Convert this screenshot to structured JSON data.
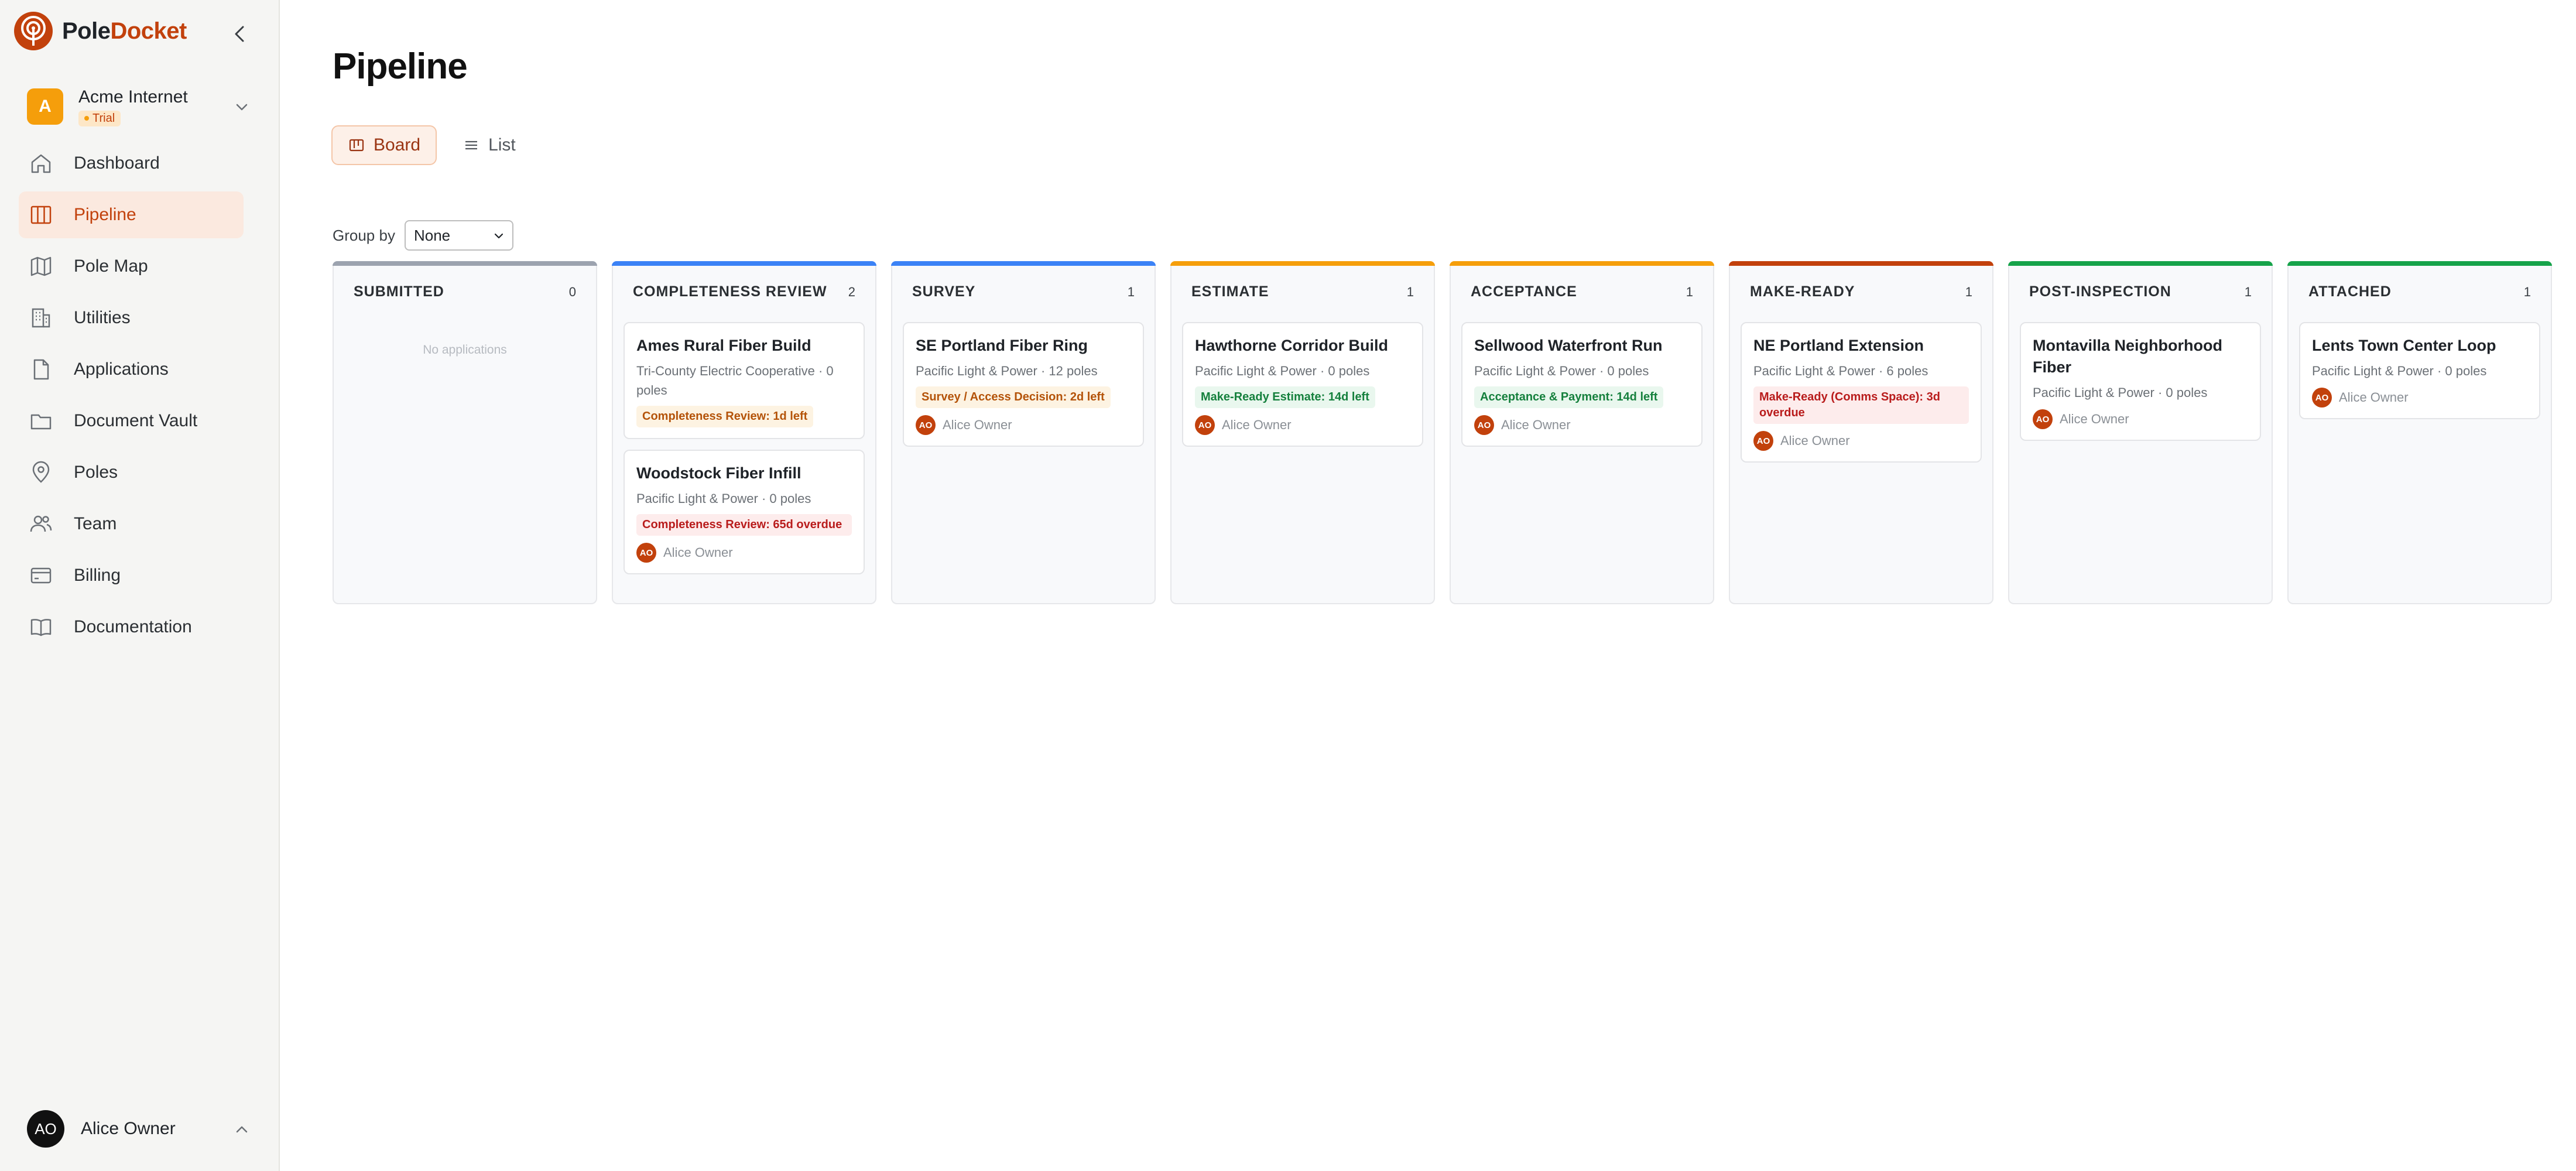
{
  "brand": {
    "name_part1": "Pole",
    "name_part2": "Docket"
  },
  "org": {
    "initial": "A",
    "name": "Acme Internet",
    "badge": "Trial"
  },
  "nav": [
    {
      "label": "Dashboard",
      "icon": "home-icon",
      "active": false
    },
    {
      "label": "Pipeline",
      "icon": "columns-icon",
      "active": true
    },
    {
      "label": "Pole Map",
      "icon": "map-icon",
      "active": false
    },
    {
      "label": "Utilities",
      "icon": "building-icon",
      "active": false
    },
    {
      "label": "Applications",
      "icon": "file-icon",
      "active": false
    },
    {
      "label": "Document Vault",
      "icon": "folder-icon",
      "active": false
    },
    {
      "label": "Poles",
      "icon": "location-pin-icon",
      "active": false
    },
    {
      "label": "Team",
      "icon": "users-icon",
      "active": false
    },
    {
      "label": "Billing",
      "icon": "credit-card-icon",
      "active": false
    },
    {
      "label": "Documentation",
      "icon": "book-icon",
      "active": false
    }
  ],
  "user": {
    "initials": "AO",
    "name": "Alice Owner"
  },
  "page": {
    "title": "Pipeline"
  },
  "view_tabs": [
    {
      "label": "Board",
      "active": true
    },
    {
      "label": "List",
      "active": false
    }
  ],
  "groupby": {
    "label": "Group by",
    "value": "None"
  },
  "columns": [
    {
      "title": "SUBMITTED",
      "count": "0",
      "color": "#9ca3af",
      "empty_text": "No applications",
      "cards": []
    },
    {
      "title": "COMPLETENESS REVIEW",
      "count": "2",
      "color": "#3b82f6",
      "empty_text": "",
      "cards": [
        {
          "title": "Ames Rural Fiber Build",
          "meta": "Tri-County Electric Cooperative · 0 poles",
          "chip": "Completeness Review: 1d left",
          "chip_tone": "amber",
          "owner_initials": "",
          "owner": ""
        },
        {
          "title": "Woodstock Fiber Infill",
          "meta": "Pacific Light & Power · 0 poles",
          "chip": "Completeness Review: 65d overdue",
          "chip_tone": "red",
          "owner_initials": "AO",
          "owner": "Alice Owner"
        }
      ]
    },
    {
      "title": "SURVEY",
      "count": "1",
      "color": "#3b82f6",
      "empty_text": "",
      "cards": [
        {
          "title": "SE Portland Fiber Ring",
          "meta": "Pacific Light & Power · 12 poles",
          "chip": "Survey / Access Decision: 2d left",
          "chip_tone": "amber",
          "owner_initials": "AO",
          "owner": "Alice Owner"
        }
      ]
    },
    {
      "title": "ESTIMATE",
      "count": "1",
      "color": "#f59e0b",
      "empty_text": "",
      "cards": [
        {
          "title": "Hawthorne Corridor Build",
          "meta": "Pacific Light & Power · 0 poles",
          "chip": "Make-Ready Estimate: 14d left",
          "chip_tone": "green",
          "owner_initials": "AO",
          "owner": "Alice Owner"
        }
      ]
    },
    {
      "title": "ACCEPTANCE",
      "count": "1",
      "color": "#f59e0b",
      "empty_text": "",
      "cards": [
        {
          "title": "Sellwood Waterfront Run",
          "meta": "Pacific Light & Power · 0 poles",
          "chip": "Acceptance & Payment: 14d left",
          "chip_tone": "green",
          "owner_initials": "AO",
          "owner": "Alice Owner"
        }
      ]
    },
    {
      "title": "MAKE-READY",
      "count": "1",
      "color": "#c2410c",
      "empty_text": "",
      "cards": [
        {
          "title": "NE Portland Extension",
          "meta": "Pacific Light & Power · 6 poles",
          "chip": "Make-Ready (Comms Space): 3d overdue",
          "chip_tone": "red",
          "owner_initials": "AO",
          "owner": "Alice Owner"
        }
      ]
    },
    {
      "title": "POST-INSPECTION",
      "count": "1",
      "color": "#16a34a",
      "empty_text": "",
      "cards": [
        {
          "title": "Montavilla Neighborhood Fiber",
          "meta": "Pacific Light & Power · 0 poles",
          "chip": "",
          "chip_tone": "",
          "owner_initials": "AO",
          "owner": "Alice Owner"
        }
      ]
    },
    {
      "title": "ATTACHED",
      "count": "1",
      "color": "#16a34a",
      "empty_text": "",
      "cards": [
        {
          "title": "Lents Town Center Loop",
          "meta": "Pacific Light & Power · 0 poles",
          "chip": "",
          "chip_tone": "",
          "owner_initials": "AO",
          "owner": "Alice Owner"
        }
      ]
    }
  ]
}
